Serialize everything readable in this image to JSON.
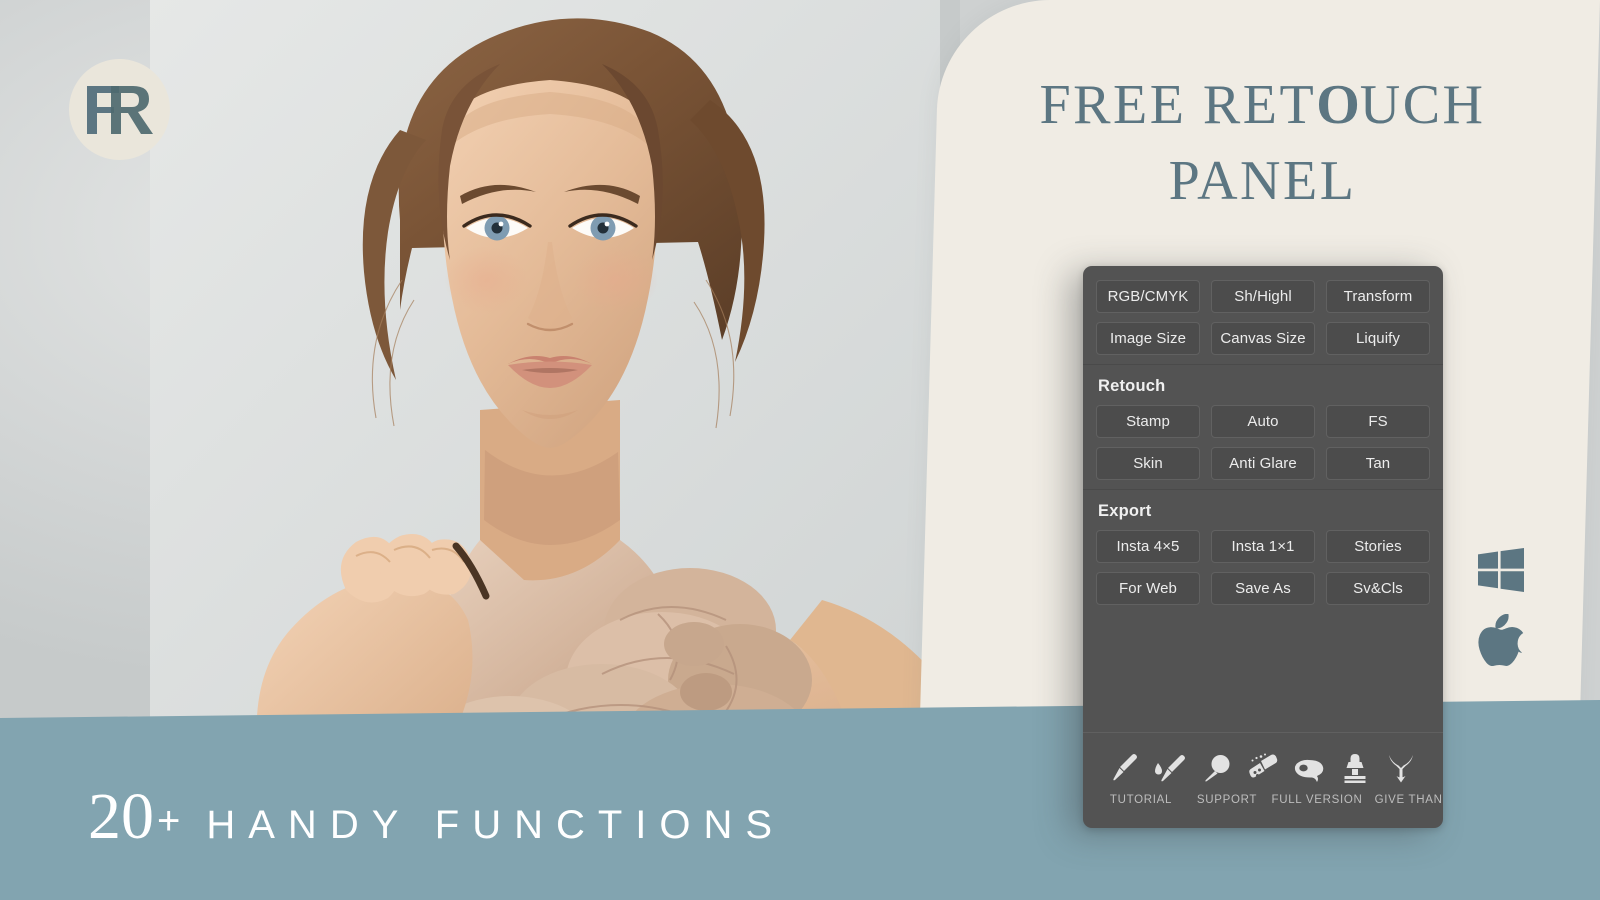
{
  "brand": {
    "logo_text": "FR",
    "logo_icon": "fr-monogram-icon"
  },
  "title": {
    "line1_pre": "FREE RET",
    "line1_heavy": "O",
    "line1_post": "UCH",
    "line2": "PANEL"
  },
  "banner": {
    "number": "20",
    "plus": "+",
    "words": "HANDY FUNCTIONS"
  },
  "os": [
    {
      "name": "windows-icon"
    },
    {
      "name": "apple-icon"
    }
  ],
  "panel": {
    "sections": [
      {
        "title": "",
        "rows": [
          [
            "RGB/CMYK",
            "Sh/Highl",
            "Transform"
          ],
          [
            "Image Size",
            "Canvas Size",
            "Liquify"
          ]
        ]
      },
      {
        "title": "Retouch",
        "rows": [
          [
            "Stamp",
            "Auto",
            "FS"
          ],
          [
            "Skin",
            "Anti Glare",
            "Tan"
          ]
        ]
      },
      {
        "title": "Export",
        "rows": [
          [
            "Insta 4×5",
            "Insta 1×1",
            "Stories"
          ],
          [
            "For Web",
            "Save As",
            "Sv&Cls"
          ]
        ]
      }
    ],
    "footer": {
      "icons": [
        "brush-icon",
        "mixer-brush-icon",
        "dodge-tool-icon",
        "patch-eraser-icon",
        "lasso-icon",
        "clone-stamp-icon",
        "branch-icon"
      ],
      "labels": [
        "TUTORIAL",
        "SUPPORT",
        "FULL VERSION",
        "GIVE THANKS"
      ]
    }
  },
  "colors": {
    "accent_teal": "#5c7682",
    "banner_blue": "#82a4b0",
    "cream": "#f0ece4",
    "panel_dark": "#535353",
    "button_dark": "#4c4c4c",
    "background_gray": "#ced1d1"
  }
}
